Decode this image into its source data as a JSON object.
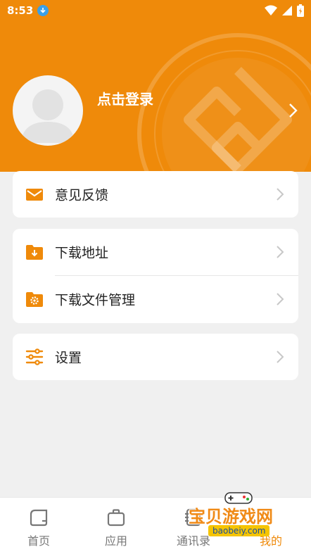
{
  "status_bar": {
    "time": "8:53"
  },
  "header": {
    "login_label": "点击登录"
  },
  "menu": {
    "feedback": "意见反馈",
    "download_address": "下载地址",
    "download_manager": "下载文件管理",
    "settings": "设置"
  },
  "tabs": {
    "home": "首页",
    "apps": "应用",
    "contacts": "通讯录",
    "mine": "我的"
  },
  "watermark": {
    "title": "宝贝游戏网",
    "url": "baobeiy.com"
  },
  "colors": {
    "accent": "#ef8a0a",
    "tab_active": "#ef8a0a",
    "background": "#f0f0f0"
  },
  "icons": [
    "download-badge-icon",
    "wifi-icon",
    "signal-icon",
    "battery-icon",
    "avatar-icon",
    "chevron-right-icon",
    "mail-icon",
    "folder-download-icon",
    "folder-gear-icon",
    "sliders-icon",
    "home-icon",
    "briefcase-icon",
    "contacts-icon"
  ]
}
